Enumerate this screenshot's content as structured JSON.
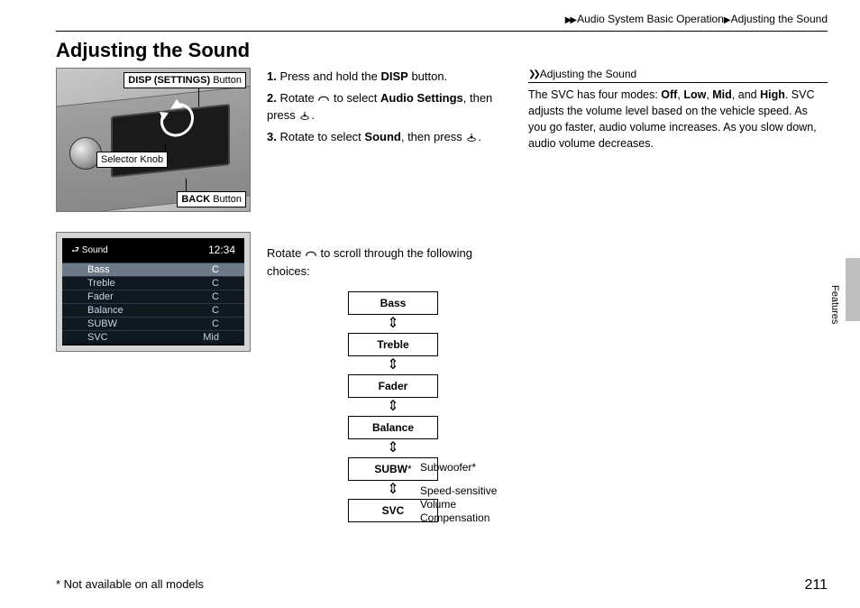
{
  "breadcrumb": {
    "seg1": "Audio System Basic Operation",
    "seg2": "Adjusting the Sound"
  },
  "title": "Adjusting the Sound",
  "callouts": {
    "disp_bold": "DISP (SETTINGS)",
    "disp_suffix": " Button",
    "selector": "Selector Knob",
    "back_bold": "BACK",
    "back_suffix": " Button"
  },
  "soundshot": {
    "header_left": "Sound",
    "header_time": "12:34",
    "rows": [
      {
        "name": "Bass",
        "val": "C"
      },
      {
        "name": "Treble",
        "val": "C"
      },
      {
        "name": "Fader",
        "val": "C"
      },
      {
        "name": "Balance",
        "val": "C"
      },
      {
        "name": "SUBW",
        "val": "C"
      },
      {
        "name": "SVC",
        "val": "Mid"
      }
    ]
  },
  "steps": {
    "s1_num": "1.",
    "s1_a": " Press and hold the ",
    "s1_b": "DISP",
    "s1_c": " button.",
    "s2_num": "2.",
    "s2_a": " Rotate ",
    "s2_b": " to select ",
    "s2_c": "Audio Settings",
    "s2_d": ", then press ",
    "s2_e": ".",
    "s3_num": "3.",
    "s3_a": " Rotate to select ",
    "s3_b": "Sound",
    "s3_c": ", then press ",
    "s3_d": "."
  },
  "scroll_intro_a": "Rotate ",
  "scroll_intro_b": " to scroll through the following choices:",
  "flow": {
    "bass": "Bass",
    "treble": "Treble",
    "fader": "Fader",
    "balance": "Balance",
    "subw": "SUBW",
    "subw_star": "*",
    "svc": "SVC",
    "subw_label": "Subwoofer",
    "svc_label_1": "Speed-sensitive",
    "svc_label_2": "Volume",
    "svc_label_3": "Compensation"
  },
  "info": {
    "heading": "Adjusting the Sound",
    "text_a": "The SVC has four modes: ",
    "off": "Off",
    "low": "Low",
    "mid": "Mid",
    "high": "High",
    "text_b": ". SVC adjusts the volume level based on the vehicle speed. As you go faster, audio volume increases. As you slow down, audio volume decreases."
  },
  "sidetab": "Features",
  "footnote": "* Not available on all models",
  "page_number": "211"
}
